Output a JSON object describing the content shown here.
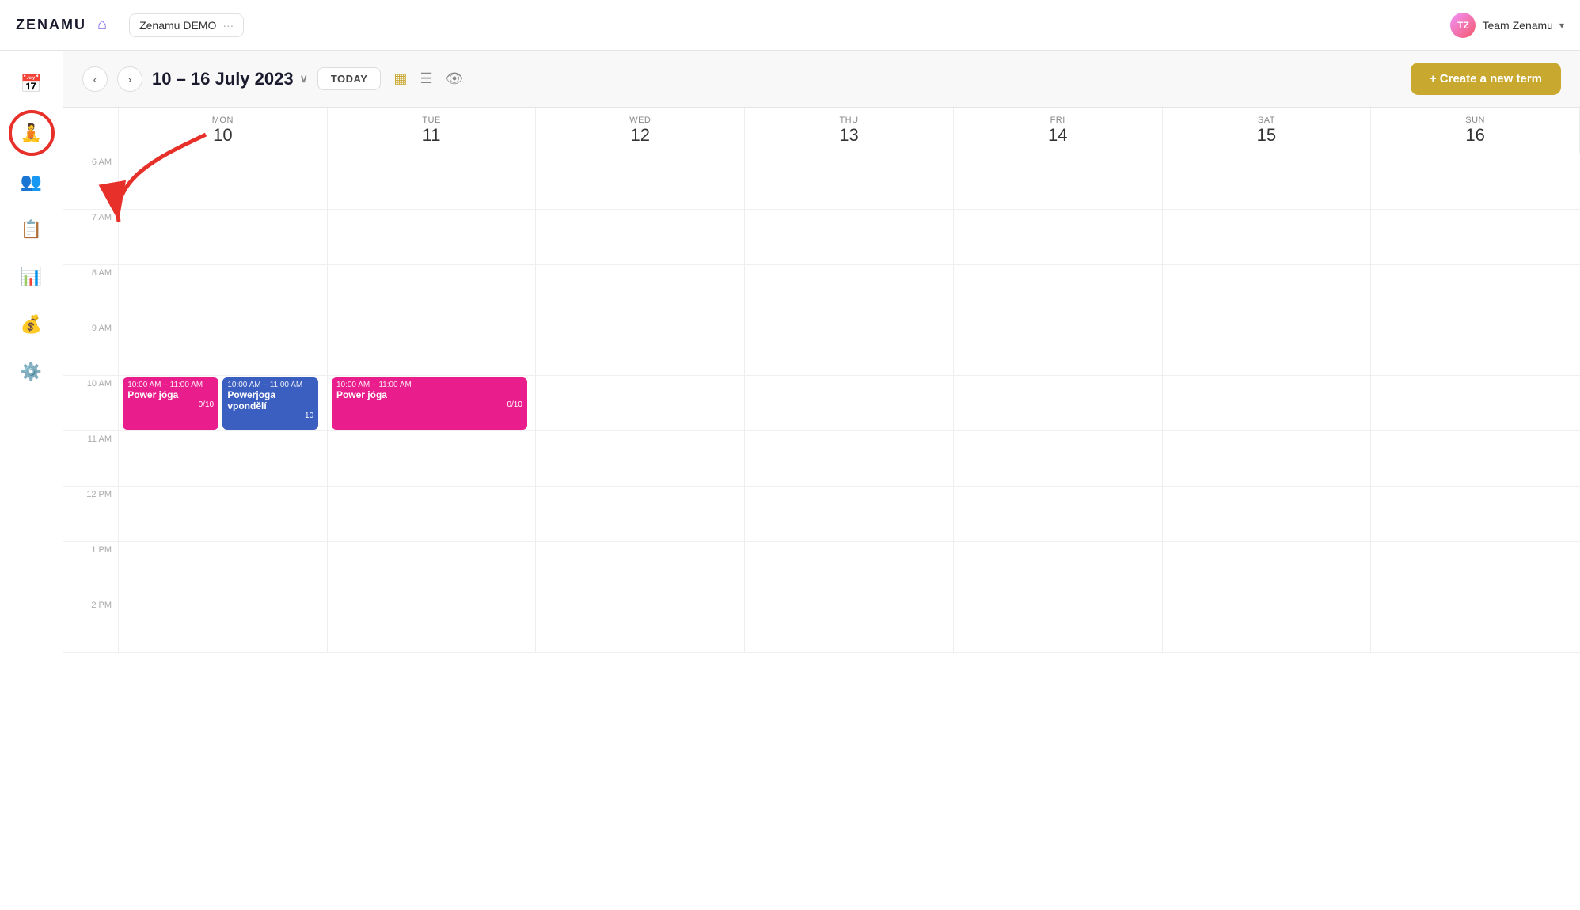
{
  "header": {
    "logo": "ZENAMU",
    "workspace": "Zenamu DEMO",
    "workspace_dots": "···",
    "user_name": "Team Zenamu",
    "chevron": "▾"
  },
  "toolbar": {
    "prev_label": "‹",
    "next_label": "›",
    "date_range": "10 – 16 July 2023",
    "date_chevron": "∨",
    "today_label": "TODAY",
    "create_term_label": "+ Create a new term"
  },
  "calendar": {
    "days": [
      {
        "name": "MON",
        "num": "10"
      },
      {
        "name": "TUE",
        "num": "11"
      },
      {
        "name": "WED",
        "num": "12"
      },
      {
        "name": "THU",
        "num": "13"
      },
      {
        "name": "FRI",
        "num": "14"
      },
      {
        "name": "SAT",
        "num": "15"
      },
      {
        "name": "SUN",
        "num": "16"
      }
    ],
    "time_slots": [
      "6 AM",
      "7 AM",
      "8 AM",
      "9 AM",
      "10 AM",
      "11 AM",
      "12 PM",
      "1 PM",
      "2 PM"
    ],
    "events": [
      {
        "day": 0,
        "color": "pink",
        "time": "10:00 AM – 11:00 AM",
        "title": "Power jóga",
        "count": "0/10",
        "offset_left": "2%",
        "width": "46%"
      },
      {
        "day": 0,
        "color": "blue",
        "time": "10:00 AM – 11:00 AM",
        "title": "Powerjoga vpondělí",
        "count": "10",
        "offset_left": "50%",
        "width": "46%"
      },
      {
        "day": 1,
        "color": "pink",
        "time": "10:00 AM – 11:00 AM",
        "title": "Power jóga",
        "count": "0/10",
        "offset_left": "2%",
        "width": "94%"
      }
    ]
  },
  "sidebar": {
    "items": [
      {
        "icon": "📅",
        "name": "calendar-icon",
        "active": false
      },
      {
        "icon": "🧘",
        "name": "classes-icon",
        "active": true
      },
      {
        "icon": "👥",
        "name": "clients-icon",
        "active": false
      },
      {
        "icon": "📋",
        "name": "notes-icon",
        "active": false
      },
      {
        "icon": "📊",
        "name": "stats-icon",
        "active": false
      },
      {
        "icon": "💰",
        "name": "billing-icon",
        "active": false
      },
      {
        "icon": "⚙️",
        "name": "settings-icon",
        "active": false
      }
    ]
  },
  "colors": {
    "accent": "#c9a830",
    "pink_event": "#e91e8c",
    "blue_event": "#3b5fc0",
    "red_circle": "#e8302a"
  }
}
